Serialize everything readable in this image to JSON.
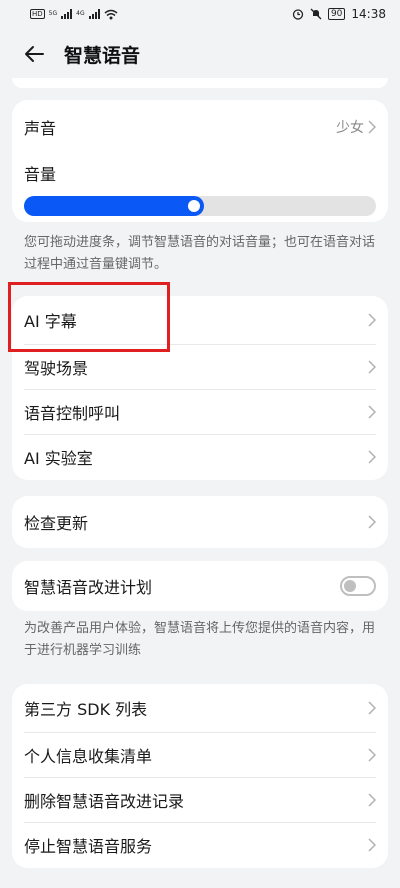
{
  "status_bar": {
    "left_labels": [
      "HD",
      "HD",
      "5G",
      "4G"
    ],
    "battery": "90",
    "time": "14:38",
    "icons": [
      "signal-icon",
      "wifi-icon",
      "alarm-icon",
      "mute-icon",
      "battery-icon"
    ]
  },
  "header": {
    "title": "智慧语音",
    "back_icon": "back-arrow-icon"
  },
  "voice_card": {
    "voice_label": "声音",
    "voice_value": "少女",
    "volume_label": "音量",
    "volume_level": 0.51,
    "accent_color": "#0a59f7"
  },
  "volume_hint": "您可拖动进度条，调节智慧语音的对话音量；也可在语音对话过程中通过音量键调节。",
  "feature_card": {
    "items": [
      {
        "label": "AI 字幕"
      },
      {
        "label": "驾驶场景"
      },
      {
        "label": "语音控制呼叫"
      },
      {
        "label": "AI 实验室"
      }
    ]
  },
  "update_card": {
    "label": "检查更新"
  },
  "improve_card": {
    "label": "智慧语音改进计划",
    "enabled": false
  },
  "improve_hint": "为改善产品用户体验，智慧语音将上传您提供的语音内容，用于进行机器学习训练",
  "legal_card": {
    "items": [
      {
        "label": "第三方 SDK 列表"
      },
      {
        "label": "个人信息收集清单"
      },
      {
        "label": "删除智慧语音改进记录"
      },
      {
        "label": "停止智慧语音服务"
      }
    ]
  },
  "annotation_color": "#e02020"
}
